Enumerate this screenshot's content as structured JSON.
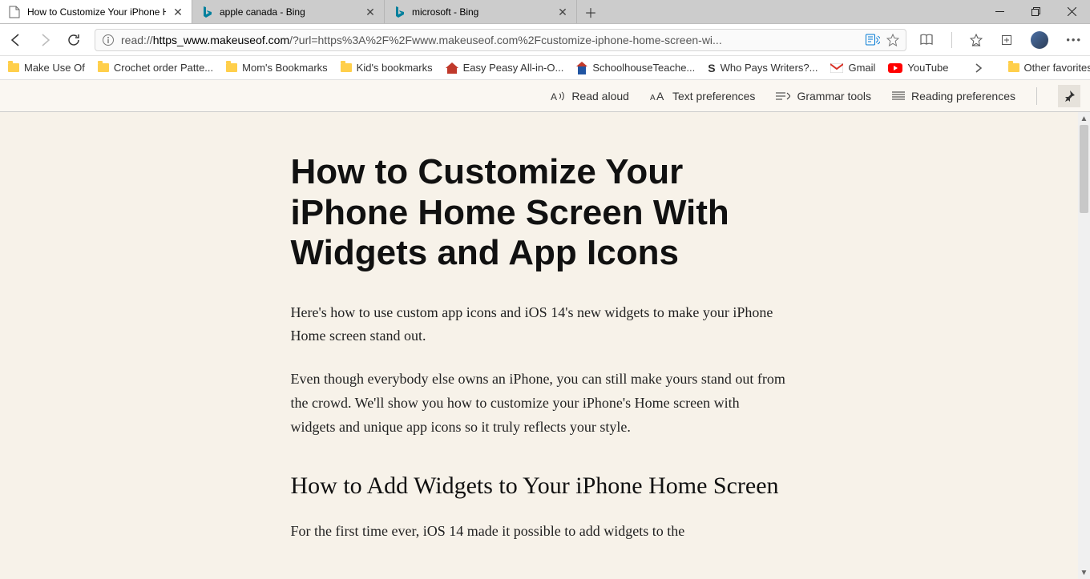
{
  "tabs": [
    {
      "title": "How to Customize Your iPhone H",
      "active": true,
      "favicon": "page"
    },
    {
      "title": "apple canada - Bing",
      "active": false,
      "favicon": "bing"
    },
    {
      "title": "microsoft - Bing",
      "active": false,
      "favicon": "bing"
    }
  ],
  "address_bar": {
    "url_prefix": "read://",
    "url_bold": "https_www.makeuseof.com",
    "url_rest": "/?url=https%3A%2F%2Fwww.makeuseof.com%2Fcustomize-iphone-home-screen-wi..."
  },
  "bookmarks": {
    "items": [
      {
        "label": "Make Use Of",
        "icon": "folder"
      },
      {
        "label": "Crochet order Patte...",
        "icon": "folder"
      },
      {
        "label": "Mom's Bookmarks",
        "icon": "folder"
      },
      {
        "label": "Kid's bookmarks",
        "icon": "folder"
      },
      {
        "label": "Easy Peasy All-in-O...",
        "icon": "house"
      },
      {
        "label": "SchoolhouseTeache...",
        "icon": "sht"
      },
      {
        "label": "Who Pays Writers?...",
        "icon": "s"
      },
      {
        "label": "Gmail",
        "icon": "gmail"
      },
      {
        "label": "YouTube",
        "icon": "youtube"
      }
    ],
    "overflow_label": "Other favorites"
  },
  "reader_toolbar": {
    "read_aloud": "Read aloud",
    "text_preferences": "Text preferences",
    "grammar_tools": "Grammar tools",
    "reading_prefs": "Reading preferences"
  },
  "article": {
    "h1": "How to Customize Your iPhone Home Screen With Widgets and App Icons",
    "p1": "Here's how to use custom app icons and iOS 14's new widgets to make your iPhone Home screen stand out.",
    "p2": "Even though everybody else owns an iPhone, you can still make yours stand out from the crowd. We'll show you how to customize your iPhone's Home screen with widgets and unique app icons so it truly reflects your style.",
    "h2": "How to Add Widgets to Your iPhone Home Screen",
    "p3": "For the first time ever, iOS 14 made it possible to add widgets to the"
  }
}
